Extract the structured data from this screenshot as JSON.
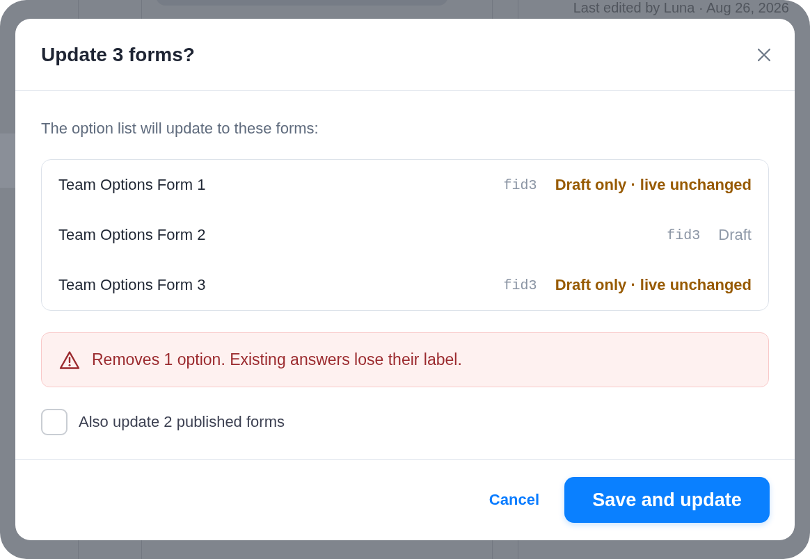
{
  "background": {
    "last_edited": "Last edited by Luna · Aug 26, 2026"
  },
  "dialog": {
    "title": "Update 3 forms?",
    "intro": "The option list will update to these forms:",
    "forms": [
      {
        "name": "Team Options Form 1",
        "id": "fid3",
        "status": "Draft only · live unchanged",
        "kind": "warning"
      },
      {
        "name": "Team Options Form 2",
        "id": "fid3",
        "status": "Draft",
        "kind": "plain"
      },
      {
        "name": "Team Options Form 3",
        "id": "fid3",
        "status": "Draft only · live unchanged",
        "kind": "warning"
      }
    ],
    "alert": {
      "kind": "danger",
      "text": "Removes 1 option. Existing answers lose their label."
    },
    "also_update": {
      "label": "Also update 2 published forms",
      "checked": false
    },
    "buttons": [
      {
        "label": "Cancel",
        "kind": "link"
      },
      {
        "label": "Save and update",
        "kind": "primary"
      }
    ]
  }
}
